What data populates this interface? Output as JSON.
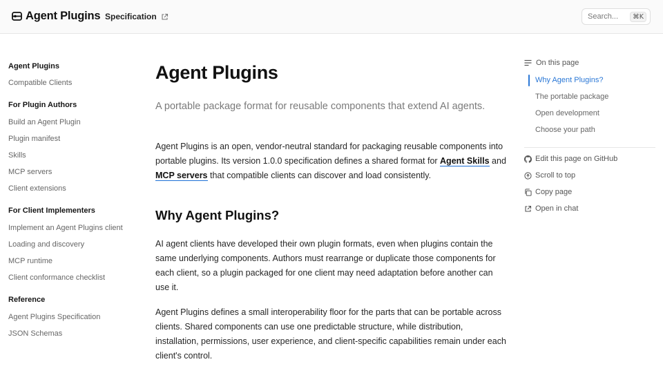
{
  "header": {
    "logo_text": "Agent Plugins",
    "spec_link": "Specification",
    "search_placeholder": "Search...",
    "search_shortcut": "⌘K"
  },
  "sidebar": {
    "sections": [
      {
        "title": "Agent Plugins",
        "items": [
          "Compatible Clients"
        ]
      },
      {
        "title": "For Plugin Authors",
        "items": [
          "Build an Agent Plugin",
          "Plugin manifest",
          "Skills",
          "MCP servers",
          "Client extensions"
        ]
      },
      {
        "title": "For Client Implementers",
        "items": [
          "Implement an Agent Plugins client",
          "Loading and discovery",
          "MCP runtime",
          "Client conformance checklist"
        ]
      },
      {
        "title": "Reference",
        "items": [
          "Agent Plugins Specification",
          "JSON Schemas"
        ]
      }
    ]
  },
  "main": {
    "title": "Agent Plugins",
    "subtitle": "A portable package format for reusable components that extend AI agents.",
    "intro": {
      "before": "Agent Plugins is an open, vendor-neutral standard for packaging reusable components into portable plugins. Its version 1.0.0 specification defines a shared format for ",
      "link1": "Agent Skills",
      "middle": " and ",
      "link2": "MCP servers",
      "after": " that compatible clients can discover and load consistently."
    },
    "section_heading": "Why Agent Plugins?",
    "para1": "AI agent clients have developed their own plugin formats, even when plugins contain the same underlying components. Authors must rearrange or duplicate those components for each client, so a plugin packaged for one client may need adaptation before another can use it.",
    "para2": "Agent Plugins defines a small interoperability floor for the parts that can be portable across clients. Shared components can use one predictable structure, while distribution, installation, permissions, user experience, and client-specific capabilities remain under each client's control."
  },
  "toc": {
    "title": "On this page",
    "items": [
      "Why Agent Plugins?",
      "The portable package",
      "Open development",
      "Choose your path"
    ],
    "active_index": 0,
    "tools": [
      "Edit this page on GitHub",
      "Scroll to top",
      "Copy page",
      "Open in chat"
    ]
  },
  "colors": {
    "accent": "#2b78d6",
    "text": "#262626",
    "muted": "#666666"
  }
}
